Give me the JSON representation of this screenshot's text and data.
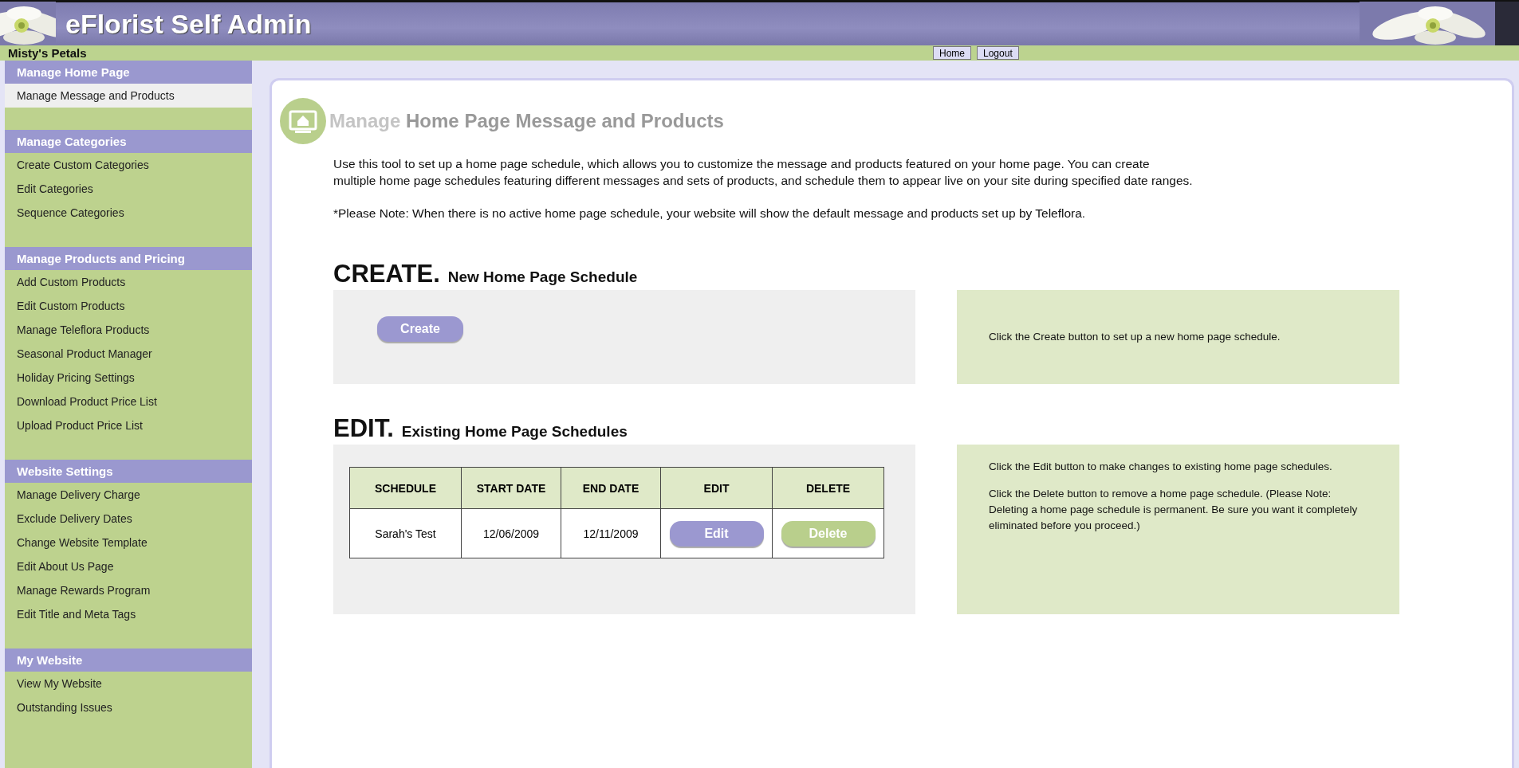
{
  "header": {
    "title": "eFlorist Self Admin",
    "shop_name": "Misty's Petals",
    "buttons": [
      "Home",
      "Logout"
    ]
  },
  "sidebar": {
    "sections": [
      {
        "heading": "Manage Home Page",
        "items": [
          {
            "label": "Manage Message and Products",
            "selected": true
          }
        ]
      },
      {
        "heading": "Manage Categories",
        "items": [
          {
            "label": "Create Custom Categories",
            "selected": false
          },
          {
            "label": "Edit Categories",
            "selected": false
          },
          {
            "label": "Sequence Categories",
            "selected": false
          }
        ]
      },
      {
        "heading": "Manage Products and Pricing",
        "items": [
          {
            "label": "Add Custom Products",
            "selected": false
          },
          {
            "label": "Edit Custom Products",
            "selected": false
          },
          {
            "label": "Manage Teleflora Products",
            "selected": false
          },
          {
            "label": "Seasonal Product Manager",
            "selected": false
          },
          {
            "label": "Holiday Pricing Settings",
            "selected": false
          },
          {
            "label": "Download Product Price List",
            "selected": false
          },
          {
            "label": "Upload Product Price List",
            "selected": false
          }
        ]
      },
      {
        "heading": "Website Settings",
        "items": [
          {
            "label": "Manage Delivery Charge",
            "selected": false
          },
          {
            "label": "Exclude Delivery Dates",
            "selected": false
          },
          {
            "label": "Change Website Template",
            "selected": false
          },
          {
            "label": "Edit About Us Page",
            "selected": false
          },
          {
            "label": "Manage Rewards Program",
            "selected": false
          },
          {
            "label": "Edit Title and Meta Tags",
            "selected": false
          }
        ]
      },
      {
        "heading": "My Website",
        "items": [
          {
            "label": "View My Website",
            "selected": false
          },
          {
            "label": "Outstanding Issues",
            "selected": false
          }
        ]
      }
    ]
  },
  "main": {
    "title_prefix": "Manage",
    "title": "Home Page Message and Products",
    "intro": "Use this tool to set up a home page schedule, which allows you to customize the message and products featured on your home page. You can create multiple home page schedules featuring different messages and sets of products, and schedule them to appear live on your site during specified date ranges.",
    "note": "*Please Note: When there is no active home page schedule, your website will show the default message and products set up by Teleflora.",
    "create": {
      "heading": "CREATE.",
      "subheading": "New Home Page Schedule",
      "button": "Create",
      "help": [
        "Click the Create button to set up a new home page schedule."
      ]
    },
    "edit": {
      "heading": "EDIT.",
      "subheading": "Existing Home Page Schedules",
      "table": {
        "columns": [
          "SCHEDULE",
          "START DATE",
          "END DATE",
          "EDIT",
          "DELETE"
        ],
        "rows": [
          {
            "schedule": "Sarah's Test",
            "start_date": "12/06/2009",
            "end_date": "12/11/2009",
            "edit_button": "Edit",
            "delete_button": "Delete"
          }
        ]
      },
      "help": [
        "Click the Edit button to make changes to existing home page schedules.",
        "Click the Delete button to remove a home page schedule. (Please Note: Deleting a home page schedule is permanent. Be sure you want it completely eliminated before you proceed.)"
      ]
    }
  }
}
